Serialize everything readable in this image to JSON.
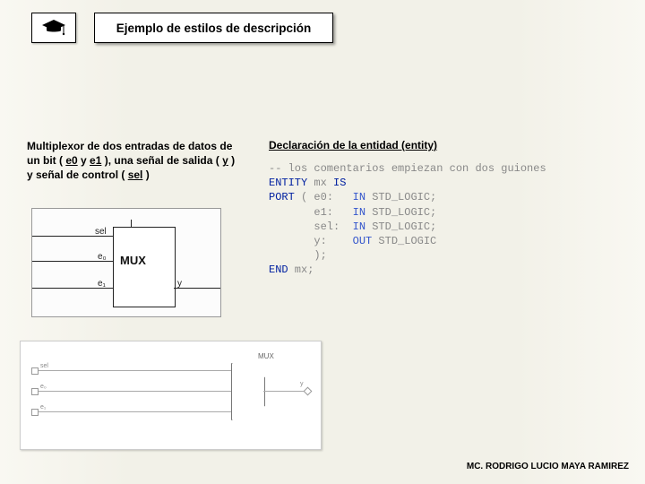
{
  "title": "Ejemplo de estilos de descripción",
  "description": {
    "prefix": "Multiplexor de dos entradas de datos de un bit ( ",
    "e0": "e0",
    "sep1": " y ",
    "e1": "e1",
    "mid": " ), una señal de salida ( ",
    "y": "y",
    "sep2": " ) y señal de control ( ",
    "sel": "sel",
    "suffix": " )"
  },
  "declaration_label": "Declaración de la entidad  (entity)",
  "code": {
    "comment": "-- los comentarios empiezan con dos guiones",
    "l2a": "ENTITY",
    "l2b": " mx ",
    "l2c": "IS",
    "l3a": "PORT",
    "l3b": " ( e0:   ",
    "l3c": "IN",
    "l3d": " STD_LOGIC;",
    "l4b": "       e1:   ",
    "l4c": "IN",
    "l4d": " STD_LOGIC;",
    "l5b": "       sel:  ",
    "l5c": "IN",
    "l5d": " STD_LOGIC;",
    "l6b": "       y:    ",
    "l6c": "OUT",
    "l6d": " STD_LOGIC",
    "l7": "       );",
    "l8a": "END",
    "l8b": " mx;"
  },
  "diagram": {
    "block_label": "MUX",
    "ports": {
      "sel": "sel",
      "e0": "e₀",
      "e1": "e₁",
      "y": "y"
    }
  },
  "rtl": {
    "label": "MUX",
    "pins": {
      "sel": "sel",
      "e0": "e₀",
      "e1": "e₁",
      "y": "y"
    }
  },
  "footer": "MC. RODRIGO LUCIO MAYA RAMIREZ"
}
